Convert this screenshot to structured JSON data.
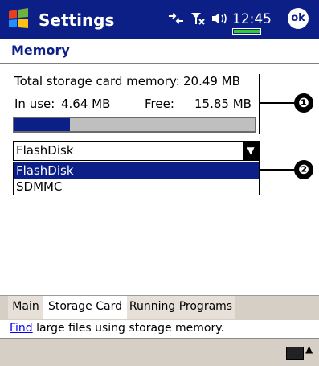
{
  "titlebar": {
    "title": "Settings",
    "time": "12:45",
    "ok_label": "ok"
  },
  "page": {
    "title": "Memory"
  },
  "storage": {
    "total_label": "Total storage card memory:",
    "total_value": "20.49 MB",
    "inuse_label": "In use:",
    "inuse_value": "4.64 MB",
    "free_label": "Free:",
    "free_value": "15.85 MB",
    "usage_fraction": 0.23
  },
  "select": {
    "value": "FlashDisk",
    "options": [
      "FlashDisk",
      "SDMMC"
    ]
  },
  "callouts": {
    "one": "❶",
    "two": "❷"
  },
  "tabs": [
    {
      "label": "Main"
    },
    {
      "label": "Storage Card"
    },
    {
      "label": "Running Programs"
    }
  ],
  "footer": {
    "link": "Find",
    "text": " large files using storage memory."
  },
  "colors": {
    "title_bg": "#0b1f86",
    "accent": "#0b1f86"
  }
}
